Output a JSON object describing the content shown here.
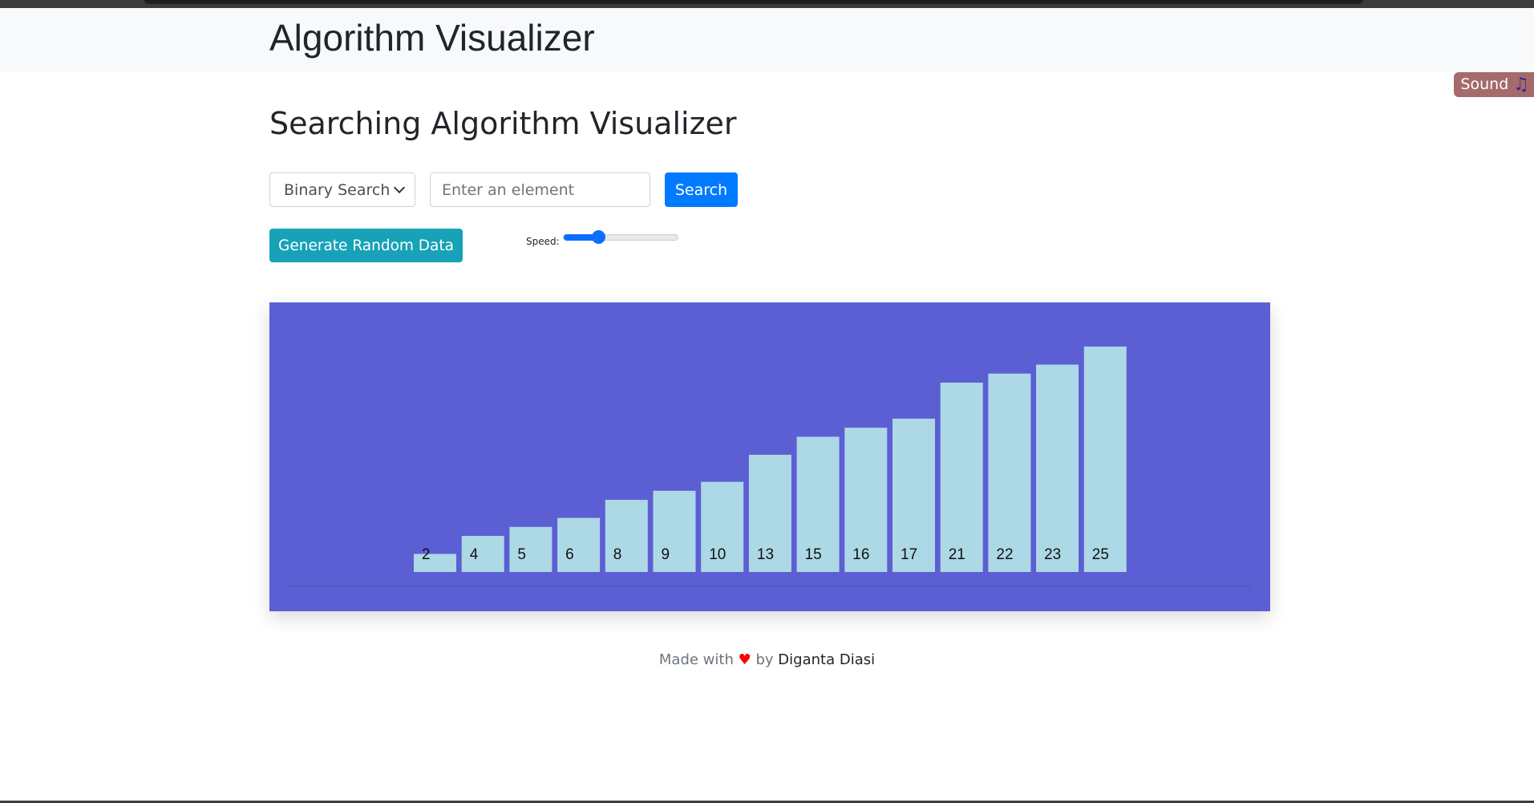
{
  "navbar": {
    "brand": "Algorithm Visualizer"
  },
  "sound": {
    "label": "Sound",
    "icon": "music-note-icon",
    "badge_color": "#a56a6c"
  },
  "main": {
    "title": "Searching Algorithm Visualizer",
    "algorithm_select": {
      "selected": "Binary Search"
    },
    "search_input": {
      "value": "",
      "placeholder": "Enter an element"
    },
    "search_button": "Search",
    "generate_button": "Generate Random Data",
    "speed": {
      "label": "Speed:",
      "value_fraction": 0.3
    }
  },
  "chart_data": {
    "type": "bar",
    "categories": [
      "2",
      "4",
      "5",
      "6",
      "8",
      "9",
      "10",
      "13",
      "15",
      "16",
      "17",
      "21",
      "22",
      "23",
      "25"
    ],
    "values": [
      2,
      4,
      5,
      6,
      8,
      9,
      10,
      13,
      15,
      16,
      17,
      21,
      22,
      23,
      25
    ],
    "bar_color": "#add8e6",
    "background_color": "#5c5fd3",
    "label_position": "bottom-inside"
  },
  "footer": {
    "prefix": "Made with",
    "heart": "♥",
    "by": "by",
    "author": "Diganta Diasi"
  },
  "colors": {
    "primary": "#007bff",
    "info": "#17a2b8",
    "navbar_bg": "#f8f9fa"
  }
}
